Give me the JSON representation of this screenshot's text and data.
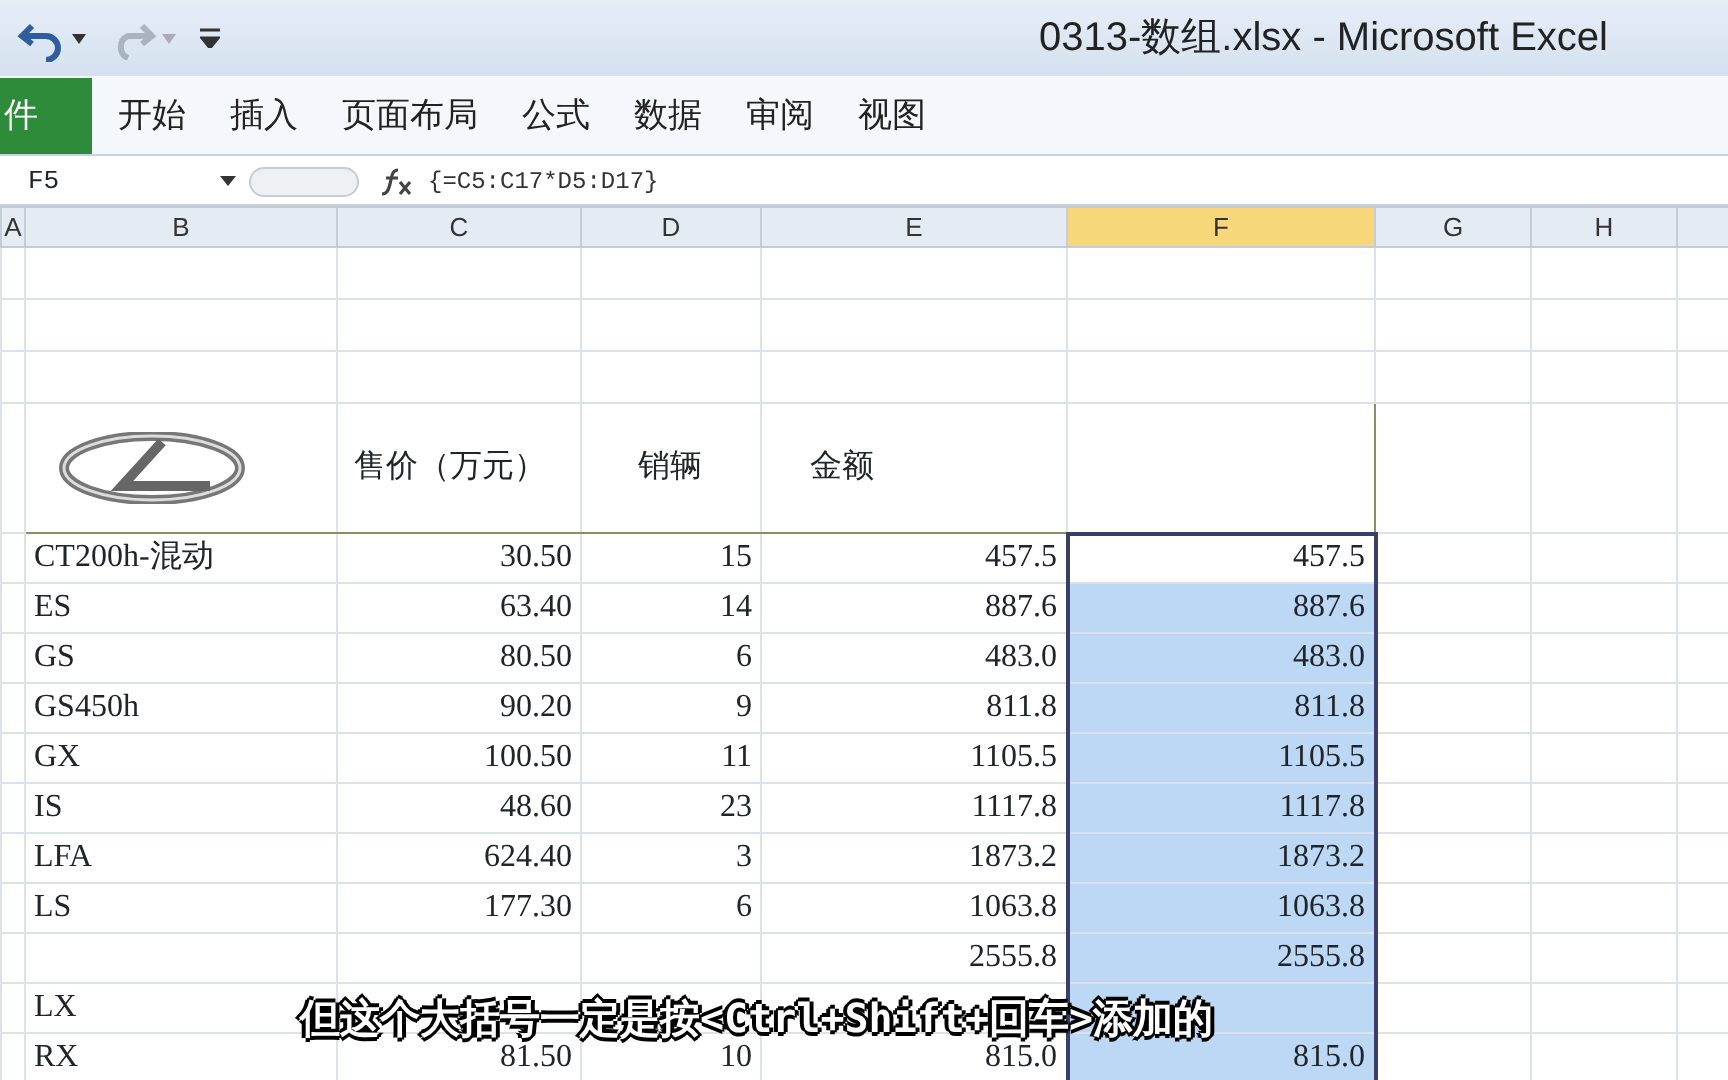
{
  "window": {
    "title": "0313-数组.xlsx - Microsoft Excel"
  },
  "ribbon_tabs": [
    {
      "label": "件",
      "kind": "file"
    },
    {
      "label": "开始",
      "kind": "tab"
    },
    {
      "label": "插入",
      "kind": "tab"
    },
    {
      "label": "页面布局",
      "kind": "tab"
    },
    {
      "label": "公式",
      "kind": "tab"
    },
    {
      "label": "数据",
      "kind": "tab"
    },
    {
      "label": "审阅",
      "kind": "tab"
    },
    {
      "label": "视图",
      "kind": "tab"
    }
  ],
  "formula_bar": {
    "name_box": "F5",
    "formula": "{=C5:C17*D5:D17}"
  },
  "columns": [
    {
      "label": "A",
      "selected": false
    },
    {
      "label": "B",
      "selected": false
    },
    {
      "label": "C",
      "selected": false
    },
    {
      "label": "D",
      "selected": false
    },
    {
      "label": "E",
      "selected": false
    },
    {
      "label": "F",
      "selected": true
    },
    {
      "label": "G",
      "selected": false
    },
    {
      "label": "H",
      "selected": false
    }
  ],
  "table": {
    "header": {
      "price": "售价（万元）",
      "quantity": "销辆",
      "amount": "金额"
    },
    "rows": [
      {
        "model": "CT200h-混动",
        "price": "30.50",
        "quantity": "15",
        "amount": "457.5",
        "result": "457.5",
        "highlighted": false
      },
      {
        "model": "ES",
        "price": "63.40",
        "quantity": "14",
        "amount": "887.6",
        "result": "887.6",
        "highlighted": true
      },
      {
        "model": "GS",
        "price": "80.50",
        "quantity": "6",
        "amount": "483.0",
        "result": "483.0",
        "highlighted": true
      },
      {
        "model": "GS450h",
        "price": "90.20",
        "quantity": "9",
        "amount": "811.8",
        "result": "811.8",
        "highlighted": true
      },
      {
        "model": "GX",
        "price": "100.50",
        "quantity": "11",
        "amount": "1105.5",
        "result": "1105.5",
        "highlighted": true
      },
      {
        "model": "IS",
        "price": "48.60",
        "quantity": "23",
        "amount": "1117.8",
        "result": "1117.8",
        "highlighted": true
      },
      {
        "model": "LFA",
        "price": "624.40",
        "quantity": "3",
        "amount": "1873.2",
        "result": "1873.2",
        "highlighted": true
      },
      {
        "model": "LS",
        "price": "177.30",
        "quantity": "6",
        "amount": "1063.8",
        "result": "1063.8",
        "highlighted": true
      },
      {
        "amount": "2555.8",
        "result": "2555.8",
        "highlighted": true
      },
      {
        "model": "LX",
        "highlighted": true
      },
      {
        "model": "RX",
        "price": "81.50",
        "quantity": "10",
        "amount": "815.0",
        "result": "815.0",
        "highlighted": true
      }
    ]
  },
  "caption": "但这个大括号一定是按<Ctrl+Shift+回车>添加的"
}
